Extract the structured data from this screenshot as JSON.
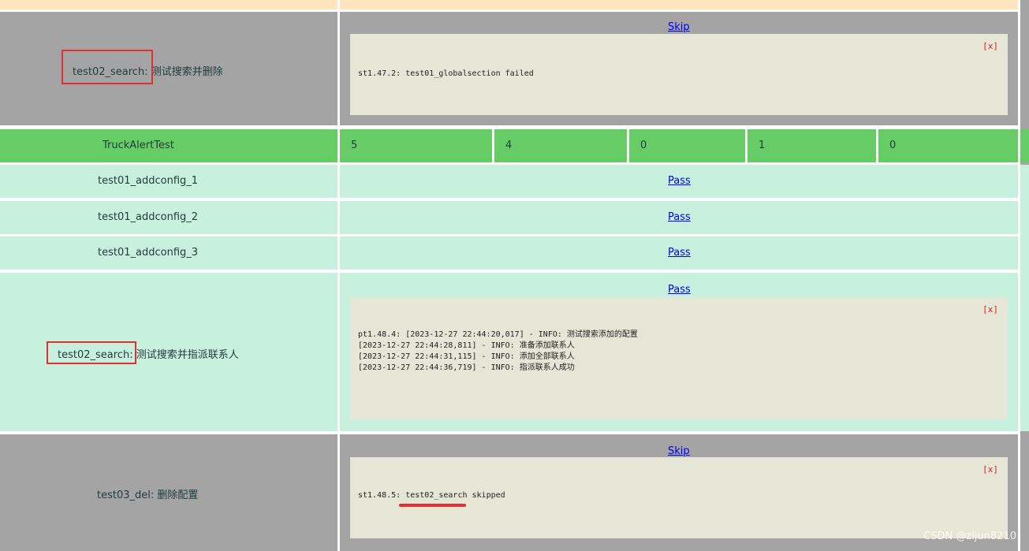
{
  "rows": {
    "suite_skip": {
      "name": "test02_search",
      "description": "测试搜索并删除",
      "status": "Skip",
      "log_close": "[x]",
      "log_text": "st1.47.2: test01_globalsection failed"
    },
    "class_header": {
      "class_name": "TruckAlertTest",
      "counts": [
        "5",
        "4",
        "0",
        "1",
        "0"
      ]
    },
    "pass_rows": [
      {
        "name": "test01_addconfig_1",
        "status": "Pass"
      },
      {
        "name": "test01_addconfig_2",
        "status": "Pass"
      },
      {
        "name": "test01_addconfig_3",
        "status": "Pass"
      }
    ],
    "search_pass": {
      "name": "test02_search",
      "description": "测试搜索并指派联系人",
      "status": "Pass",
      "log_close": "[x]",
      "log_text": "pt1.48.4: [2023-12-27 22:44:20,017] - INFO: 测试搜索添加的配置\n[2023-12-27 22:44:28,811] - INFO: 准备添加联系人\n[2023-12-27 22:44:31,115] - INFO: 添加全部联系人\n[2023-12-27 22:44:36,719] - INFO: 指派联系人成功"
    },
    "del_skip": {
      "name": "test03_del",
      "description": "删除配置",
      "status": "Skip",
      "log_close": "[x]",
      "log_prefix": "st1.48.5: ",
      "log_highlight": "test02_search",
      "log_suffix": " skipped"
    }
  },
  "watermark": "CSDN @zljun8210",
  "colors": {
    "skip_row": "#a4a4a4",
    "class_row": "#66cc66",
    "pass_row": "#c8f0de",
    "log_bg": "#e6e6d6",
    "annotation": "#e03030"
  }
}
